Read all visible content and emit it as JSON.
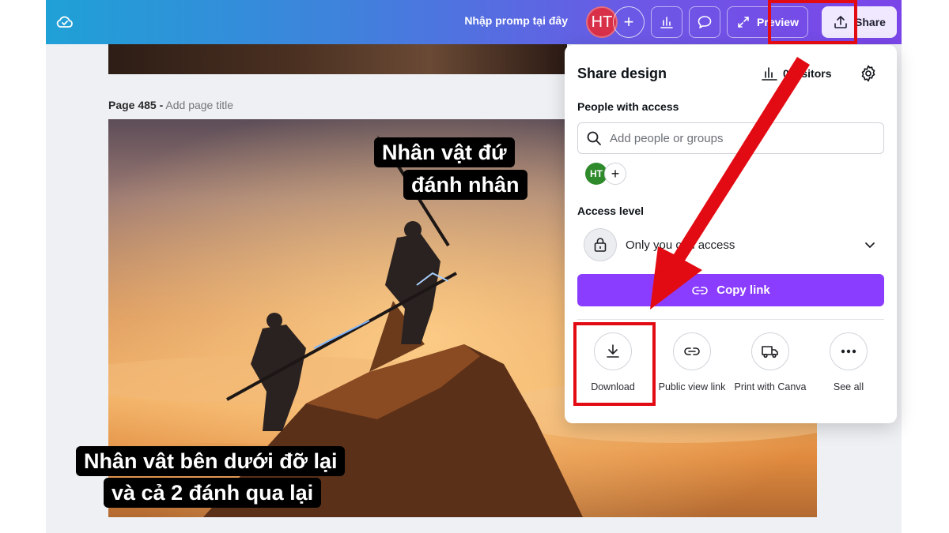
{
  "topbar": {
    "doc_title": "Nhập promp tại đây",
    "avatar_initials": "HT",
    "add_label": "+",
    "preview_label": "Preview",
    "share_label": "Share"
  },
  "canvas": {
    "page_number": "Page 485 -",
    "page_title_placeholder": "Add page title",
    "caption_top_line1": "Nhân vật đứ",
    "caption_top_line2": "đánh nhân",
    "caption_bottom_line1": "Nhân vât bên dưới đỡ lại",
    "caption_bottom_line2": "và cả 2 đánh qua lại"
  },
  "share_panel": {
    "title": "Share design",
    "visitors_label": "0 visitors",
    "people_label": "People with access",
    "search_placeholder": "Add people or groups",
    "member_initials": "HT",
    "access_level_label": "Access level",
    "access_value": "Only you can access",
    "copy_link_label": "Copy link",
    "options": [
      {
        "label": "Download",
        "icon": "download-icon"
      },
      {
        "label": "Public view link",
        "icon": "link-icon"
      },
      {
        "label": "Print with Canva",
        "icon": "truck-icon"
      },
      {
        "label": "See all",
        "icon": "more-icon"
      }
    ]
  },
  "colors": {
    "accent": "#8b3dff",
    "highlight": "#e30b13",
    "avatar_red": "#d9304a",
    "avatar_green": "#2e8a2a"
  }
}
